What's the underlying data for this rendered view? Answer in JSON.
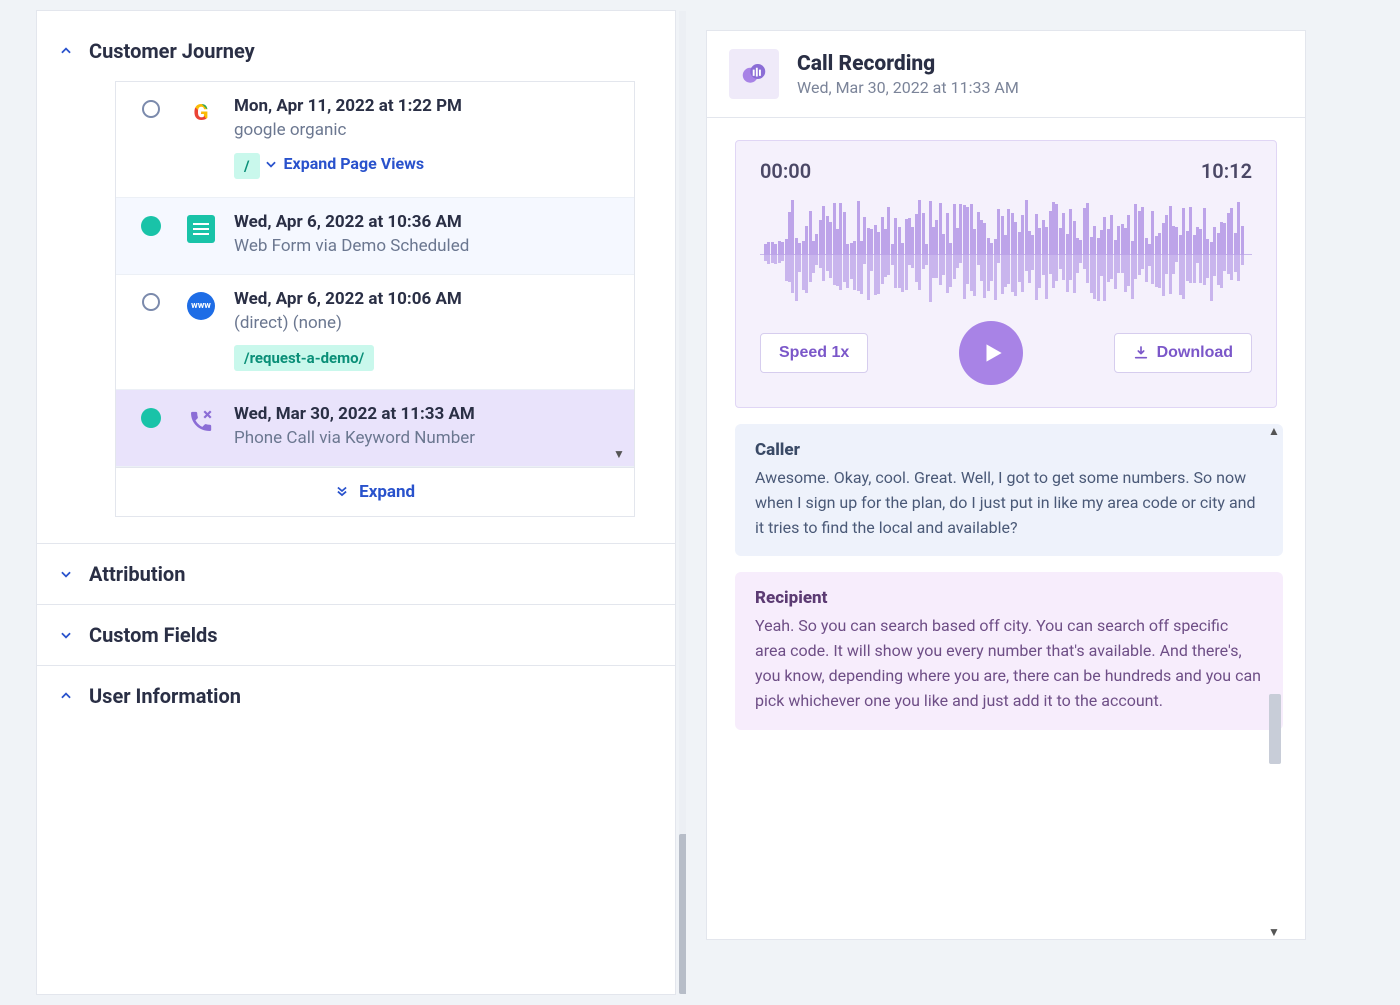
{
  "colors": {
    "accent_blue": "#2952cc",
    "accent_purple": "#8b6dd6",
    "accent_teal": "#19c3a8"
  },
  "left": {
    "sections": {
      "journey_title": "Customer Journey",
      "attribution_title": "Attribution",
      "custom_fields_title": "Custom Fields",
      "user_info_title": "User Information"
    },
    "journey": [
      {
        "date": "Mon, Apr 11, 2022 at 1:22 PM",
        "desc": "google organic",
        "path": "/",
        "expand_label": "Expand Page Views"
      },
      {
        "date": "Wed, Apr 6, 2022 at 10:36 AM",
        "desc": "Web Form via Demo Scheduled"
      },
      {
        "date": "Wed, Apr 6, 2022 at 10:06 AM",
        "desc": "(direct) (none)",
        "path": "/request-a-demo/"
      },
      {
        "date": "Wed, Mar 30, 2022 at 11:33 AM",
        "desc": "Phone Call via Keyword Number"
      }
    ],
    "expand_button": "Expand"
  },
  "recording": {
    "title": "Call Recording",
    "timestamp": "Wed, Mar 30, 2022 at 11:33 AM",
    "current_time": "00:00",
    "total_time": "10:12",
    "speed_label": "Speed 1x",
    "download_label": "Download",
    "transcript": [
      {
        "who": "Caller",
        "text": "Awesome. Okay, cool. Great. Well, I got to get some numbers. So now when I sign up for the plan, do I just put in like my area code or city and it tries to find the local and available?"
      },
      {
        "who": "Recipient",
        "text": "Yeah. So you can search based off city. You can search off specific area code. It will show you every number that's available. And there's, you know, depending where you are, there can be hundreds and you can pick whichever one you like and just add it to the account."
      }
    ]
  }
}
